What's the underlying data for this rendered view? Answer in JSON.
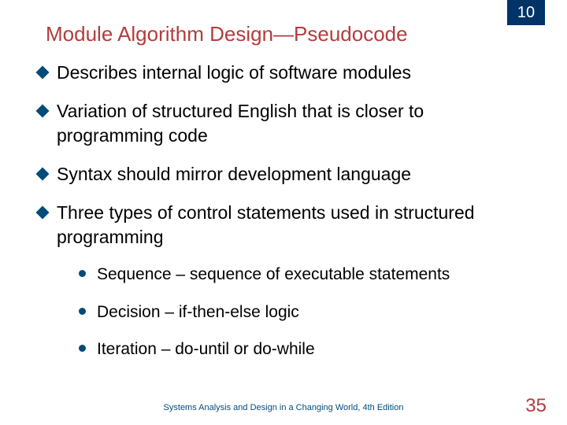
{
  "chapter": "10",
  "title": "Module Algorithm Design—Pseudocode",
  "bullets": [
    {
      "text": "Describes internal logic of software modules"
    },
    {
      "text": "Variation of structured English that is closer to programming code"
    },
    {
      "text": "Syntax should mirror development language"
    },
    {
      "text": "Three types of control statements used in structured programming"
    }
  ],
  "subbullets": [
    {
      "text": "Sequence – sequence of executable statements"
    },
    {
      "text": "Decision – if-then-else logic"
    },
    {
      "text": "Iteration – do-until or do-while"
    }
  ],
  "footer": "Systems Analysis and Design in a Changing World, 4th Edition",
  "page": "35"
}
